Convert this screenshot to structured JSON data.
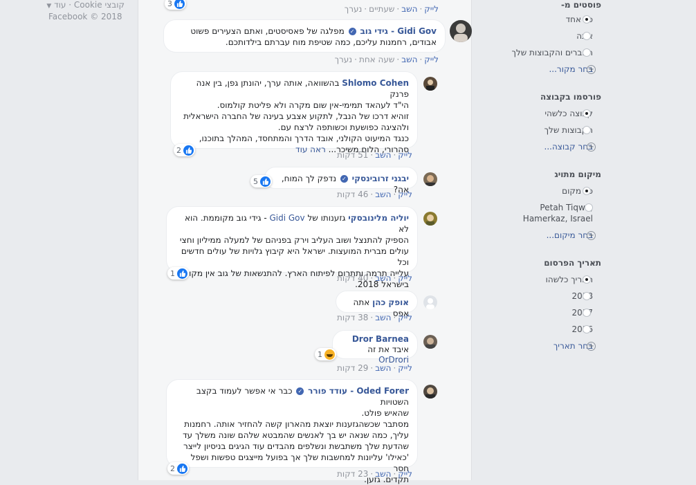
{
  "footer": {
    "cookies": "קובצי Cookie",
    "more": "עוד",
    "copyright": "Facebook © 2018"
  },
  "filters": {
    "posts_from": {
      "title": "פוסטים מ-",
      "options": [
        {
          "label": "כל אחד",
          "selected": true
        },
        {
          "label": "אתה",
          "selected": false
        },
        {
          "label": "החברים והקבוצות שלך",
          "selected": false
        }
      ],
      "more": "בחר מקור..."
    },
    "posted_in_group": {
      "title": "פורסמו בקבוצה",
      "options": [
        {
          "label": "קבוצה כלשהי",
          "selected": true
        },
        {
          "label": "הקבוצות שלך",
          "selected": false
        }
      ],
      "more": "בחר קבוצה..."
    },
    "tagged_location": {
      "title": "מיקום מתויג",
      "options": [
        {
          "label": "כל מקום",
          "selected": true
        },
        {
          "label": "Petah Tiqwa, Hamerkaz, Israel",
          "selected": false
        }
      ],
      "more": "בחר מיקום..."
    },
    "date_posted": {
      "title": "תאריך הפרסום",
      "options": [
        {
          "label": "תאריך כלשהו",
          "selected": true
        },
        {
          "label": "2018",
          "selected": false
        },
        {
          "label": "2017",
          "selected": false
        },
        {
          "label": "2016",
          "selected": false
        }
      ],
      "more": "בחר תאריך"
    }
  },
  "actions": {
    "like": "לייק",
    "reply": "השב",
    "edited": "נערך"
  },
  "comments": [
    {
      "time": "שעתיים",
      "edited": true,
      "reactions": "3"
    },
    {
      "name": "Gidi Gov - גידי גוב",
      "verified": true,
      "text": "מפלגה של פאסיסטים, ואתם הצעירים פשוט אבודים, רחמנות עליכם, כמה שטיפת מוח עברתם בילדותכם.",
      "time": "שעה אחת",
      "edited": true
    },
    {
      "name": "Shlomo Cohen",
      "lines": [
        "בהשוואה, אותה ערך, יהונתן גפן, בין אנה פרנק",
        "הי\"ד לעהאד תמימי-אין שום מקרה ולא פליטת קולמוס.",
        "זוהיא דרכו של הנבל, לתקוע אצבע בעינה של החברה הישראלית",
        "ולהציגה כפושעת וכשותפה לרצח עם.",
        "כנגד המיעוט הקולני, אובד הדרך והמתחסד, המהלך בתוכנו,",
        "סהרורי, הלום משיכר..."
      ],
      "see_more": "ראה עוד",
      "time": "51 דקות",
      "reactions": "2"
    },
    {
      "name": "יבגני זרובינסקי",
      "verified": true,
      "text": "נדפק לך המוח, אה?",
      "time": "46 דקות",
      "reactions": "5"
    },
    {
      "name": "יוליה מלינובסקי",
      "tag": "Gidi Gov",
      "lines_after_tag": " - גידי גוב מקוממת. הוא לא",
      "lines": [
        "גזענותו של",
        "הספיק להתנצל ושוב העליב וירק בפניהם של למעלה ממיליון וחצי",
        "עולים מברית המועצות. ישראל היא קיבוץ גלויות של עולים חדשים וכל",
        "עלייה תרמה ותתרום לפיתוח הארץ. להתנשאות של גוב אין מקום",
        "בישראל 2018."
      ],
      "time": "40 דקות",
      "reactions": "1"
    },
    {
      "name": "אופק כהן",
      "text": "אתה אפס",
      "time": "38 דקות"
    },
    {
      "name": "Dror Barnea",
      "text": "איבד את זה",
      "tag": "OrDrori",
      "time": "29 דקות",
      "reactions": "1"
    },
    {
      "name": "Oded Forer - עודד פורר",
      "verified": true,
      "lines": [
        "כבר אי אפשר לעמוד בקצב השטויות",
        "שהאיש פולט.",
        "מסתבר שכשהגזענות יוצאת מהארון קשה להחזיר אותה. רחמנות",
        "עליך, כמה שנאה יש בך לאנשים שהמבטא שלהם שונה משלך עד",
        "שהדעת שלך משתבשת ונשלפים מהבדים עוד הגיגים בניסיון לייצר",
        "'כאילו' עליונות למחשבות שלך אך בפועל מייצגים טפשות ושפל חסר",
        "תקדים. גזען."
      ],
      "time": "23 דקות",
      "reactions": "2"
    }
  ],
  "colors": {
    "link": "#385898",
    "like_blue": "#1877f2",
    "bg": "#e9ebee"
  }
}
